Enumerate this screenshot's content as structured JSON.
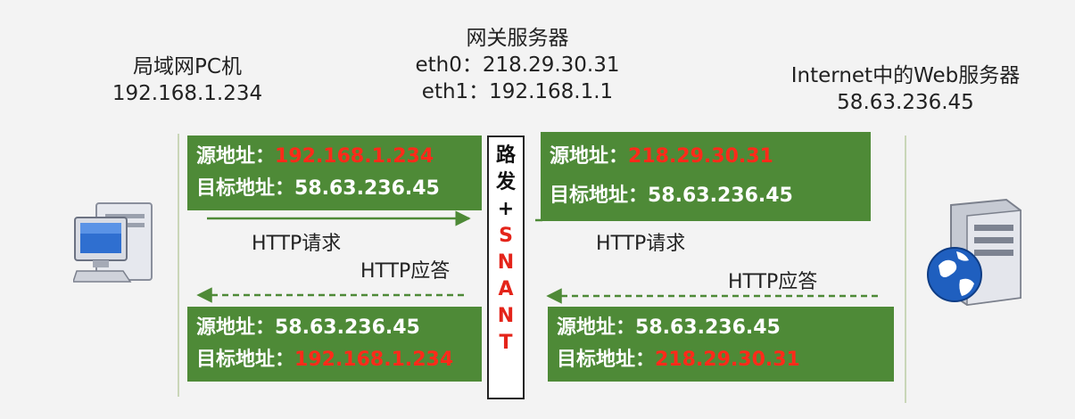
{
  "lan_pc": {
    "title": "局域网PC机",
    "ip": "192.168.1.234",
    "icon": "desktop-computer-icon"
  },
  "gateway": {
    "title": "网关服务器",
    "eth0": "eth0：218.29.30.31",
    "eth1": "eth1：192.168.1.1"
  },
  "web_server": {
    "title": "Internet中的Web服务器",
    "ip": "58.63.236.45",
    "icon": "server-globe-icon"
  },
  "router_label": {
    "chars_black": [
      "路",
      "发",
      "+"
    ],
    "chars_red": [
      "S",
      "N",
      "A",
      "N",
      "T"
    ]
  },
  "packets": {
    "lan_request": {
      "src_label": "源地址：",
      "src_value": "192.168.1.234",
      "dst_label": "目标地址：",
      "dst_value": "58.63.236.45"
    },
    "wan_request": {
      "src_label": "源地址：",
      "src_value": "218.29.30.31",
      "dst_label": "目标地址：",
      "dst_value": "58.63.236.45"
    },
    "lan_response": {
      "src_label": "源地址：",
      "src_value": "58.63.236.45",
      "dst_label": "目标地址：",
      "dst_value": "192.168.1.234"
    },
    "wan_response": {
      "src_label": "源地址：",
      "src_value": "58.63.236.45",
      "dst_label": "目标地址：",
      "dst_value": "218.29.30.31"
    }
  },
  "arrows": {
    "left_request": "HTTP请求",
    "left_response": "HTTP应答",
    "right_request": "HTTP请求",
    "right_response": "HTTP应答"
  },
  "colors": {
    "box_green": "#4e8a37",
    "highlight_red": "#ff2a1a",
    "arrow_green": "#4e8a37"
  }
}
